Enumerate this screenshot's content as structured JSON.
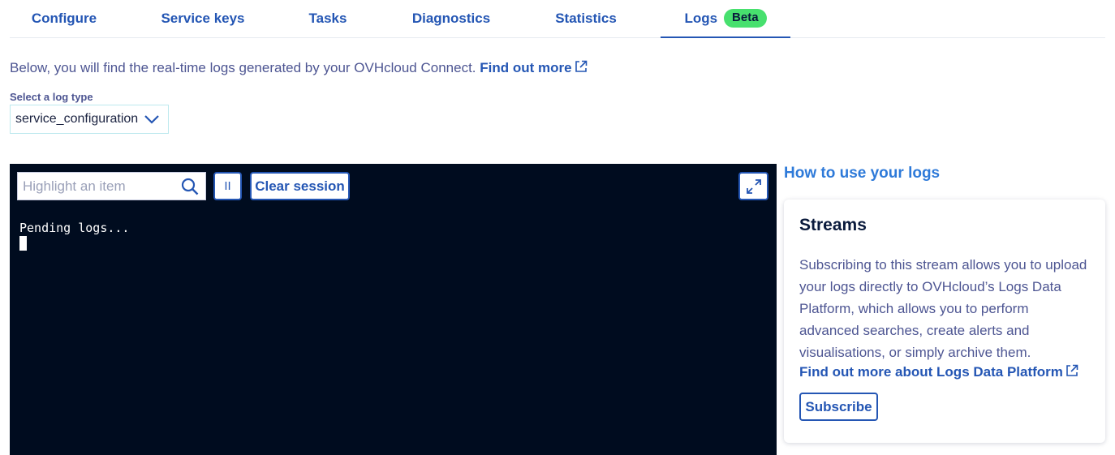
{
  "tabs": [
    {
      "label": "Configure"
    },
    {
      "label": "Service keys"
    },
    {
      "label": "Tasks"
    },
    {
      "label": "Diagnostics"
    },
    {
      "label": "Statistics"
    },
    {
      "label": "Logs",
      "badge": "Beta",
      "active": true
    }
  ],
  "intro": {
    "text": "Below, you will find the real-time logs generated by your OVHcloud Connect.",
    "link": "Find out more"
  },
  "log_type": {
    "label": "Select a log type",
    "selected": "service_configuration"
  },
  "terminal": {
    "search_placeholder": "Highlight an item",
    "pause_label": "II",
    "clear_label": "Clear session",
    "status_text": "Pending logs..."
  },
  "side": {
    "howto_link": "How to use your logs",
    "card": {
      "title": "Streams",
      "description": "Subscribing to this stream allows you to upload your logs directly to OVHcloud’s Logs Data Platform, which allows you to perform advanced searches, create alerts and visualisations, or simply archive them.",
      "link": "Find out more about Logs Data Platform",
      "button": "Subscribe"
    }
  },
  "colors": {
    "primary": "#2456b4",
    "badge": "#47e06e",
    "terminal_bg": "#000c1f",
    "text": "#4d5592"
  }
}
